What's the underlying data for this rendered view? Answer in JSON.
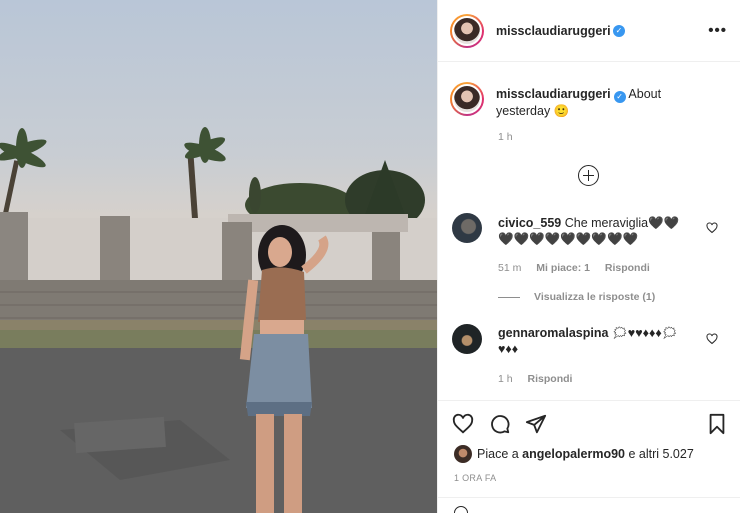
{
  "post": {
    "username": "missclaudiaruggeri",
    "more_icon": "more-horizontal-icon",
    "caption": {
      "username": "missclaudiaruggeri",
      "text": "About yesterday 🙂",
      "time": "1 h"
    },
    "load_more_icon": "plus-circle-icon",
    "comments": [
      {
        "username": "civico_559",
        "text": "Che meraviglia🖤🖤🖤🖤🖤🖤🖤🖤🖤🖤🖤",
        "time": "51 m",
        "likes": "Mi piace: 1",
        "reply": "Rispondi",
        "view_replies": "Visualizza le risposte (1)"
      },
      {
        "username": "gennaromalaspina",
        "text": "🗯♥♥♦♦♦🗯♥♦♦",
        "time": "1 h",
        "reply": "Rispondi"
      }
    ],
    "likes_text_prefix": "Piace a ",
    "likes_user": "angelopalermo90",
    "likes_text_suffix": " e altri 5.027",
    "date": "1 ORA FA"
  },
  "colors": {
    "verified": "#3897f0",
    "text": "#262626",
    "muted": "#8e8e8e",
    "border": "#efefef"
  }
}
